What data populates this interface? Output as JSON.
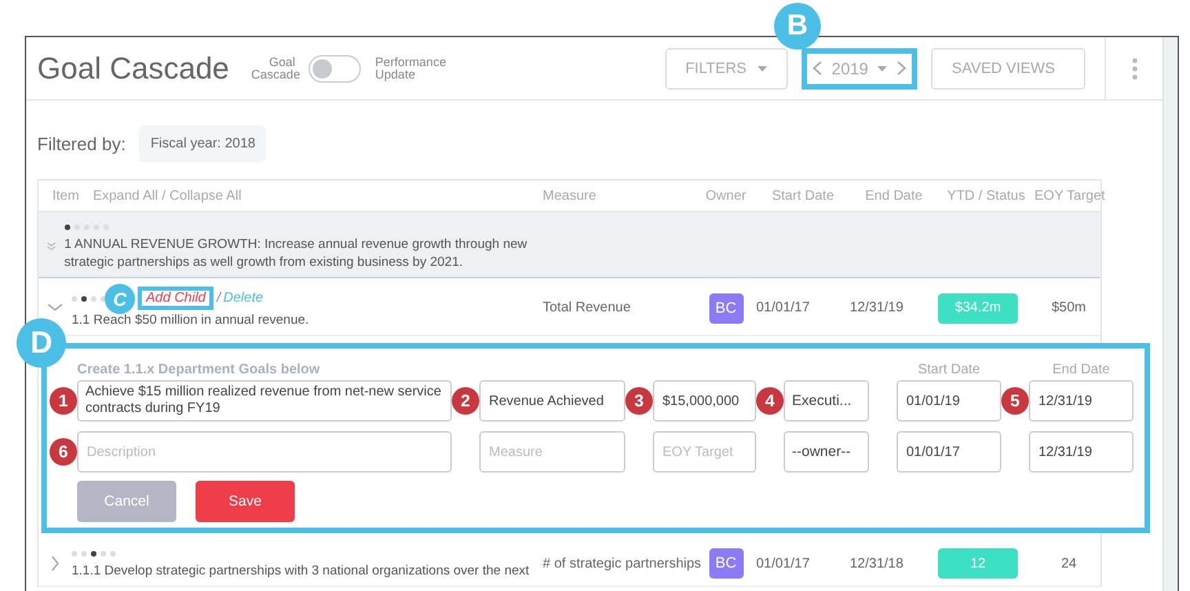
{
  "header": {
    "title": "Goal Cascade",
    "toggle": {
      "left_label": "Goal Cascade",
      "right_label": "Performance Update",
      "on": false
    },
    "filters_button": "FILTERS",
    "year": {
      "value": "2019",
      "callout": {
        "label": "B",
        "color": "#4bbfe6"
      }
    },
    "saved_views": "SAVED VIEWS"
  },
  "filter": {
    "label": "Filtered by:",
    "chips": [
      "Fiscal year: 2018"
    ]
  },
  "table": {
    "columns": [
      "Item",
      "Expand All / Collapse All",
      "Measure",
      "Owner",
      "Start Date",
      "End Date",
      "YTD / Status",
      "EOY Target"
    ],
    "rows": [
      {
        "number": "1",
        "text": "ANNUAL REVENUE GROWTH: Increase annual revenue growth through new strategic partnerships as well growth from existing business by 2021.",
        "expanded": true,
        "children": [
          {
            "number": "1.1",
            "text": "Reach $50 million in annual revenue.",
            "measure": "Total Revenue",
            "owner": "BC",
            "start": "01/01/17",
            "end": "12/31/19",
            "ytd": "$34.2m",
            "eoy": "$50m",
            "expanded": true,
            "actions": {
              "add": "Add Child",
              "separator": "/",
              "delete": "Delete",
              "callout": {
                "label": "C",
                "color": "#4bbfe6"
              }
            },
            "form": {
              "title": "Create 1.1.x Department Goals below",
              "start_label": "Start Date",
              "end_label": "End Date",
              "callout": {
                "label": "D",
                "color": "#4bbfe6"
              },
              "rows": [
                [
                  {
                    "kind": "textarea",
                    "value": "Achieve $15 million realized revenue from net-new service contracts during FY19",
                    "callout": {
                      "label": "1",
                      "color": "#c9373f"
                    }
                  },
                  {
                    "kind": "input",
                    "value": "Revenue Achieved",
                    "callout": {
                      "label": "2",
                      "color": "#c9373f"
                    }
                  },
                  {
                    "kind": "input",
                    "value": "$15,000,000",
                    "callout": {
                      "label": "3",
                      "color": "#c9373f"
                    }
                  },
                  {
                    "kind": "select",
                    "value": "Executi...",
                    "callout": {
                      "label": "4",
                      "color": "#c9373f"
                    }
                  },
                  {
                    "kind": "input",
                    "value": "01/01/19"
                  },
                  {
                    "kind": "input",
                    "value": "12/31/19",
                    "callout": {
                      "label": "5",
                      "color": "#c9373f"
                    }
                  }
                ],
                [
                  {
                    "kind": "input",
                    "placeholder": "Description",
                    "callout": {
                      "label": "6",
                      "color": "#c9373f"
                    }
                  },
                  {
                    "kind": "input",
                    "placeholder": "Measure"
                  },
                  {
                    "kind": "input",
                    "placeholder": "EOY Target"
                  },
                  {
                    "kind": "select",
                    "value": "--owner--"
                  },
                  {
                    "kind": "input",
                    "value": "01/01/17"
                  },
                  {
                    "kind": "input",
                    "value": "12/31/19"
                  }
                ]
              ],
              "buttons": {
                "cancel": "Cancel",
                "save": "Save"
              }
            },
            "children": [
              {
                "number": "1.1.1",
                "text": "Develop strategic partnerships with 3 national organizations over the next",
                "measure": "# of strategic partnerships",
                "owner": "BC",
                "start": "01/01/17",
                "end": "12/31/18",
                "ytd": "12",
                "eoy": "24",
                "expanded": false
              }
            ]
          }
        ]
      }
    ]
  }
}
